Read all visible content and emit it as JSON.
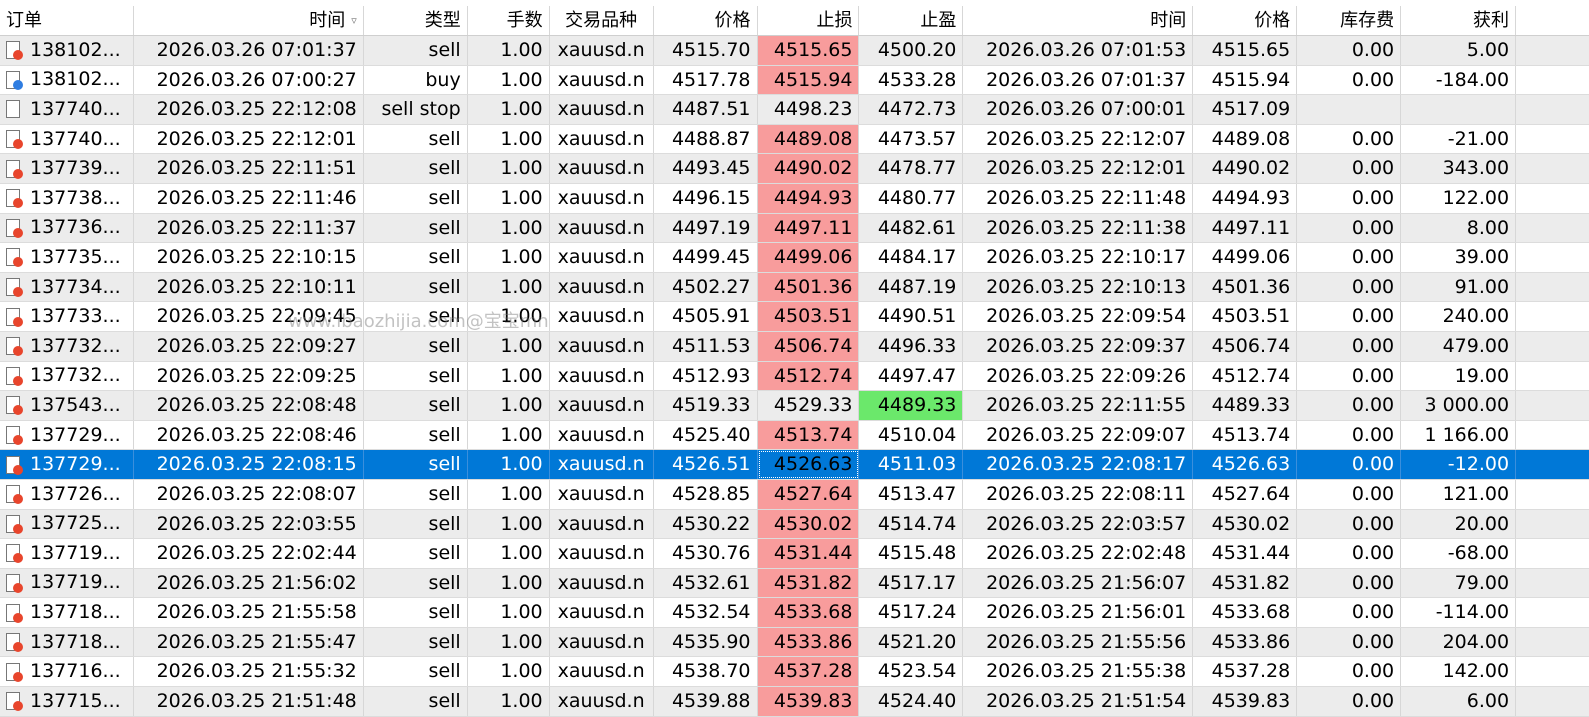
{
  "headers": [
    "订单",
    "时间",
    "类型",
    "手数",
    "交易品种",
    "价格",
    "止损",
    "止盈",
    "时间",
    "价格",
    "库存费",
    "获利"
  ],
  "sort_indicator": "▿",
  "watermark": "www.ibaozhijia.com@宝宝mn",
  "colors": {
    "sl_red": "#f89c9c",
    "tp_green": "#6be86b",
    "selected": "#0078d7",
    "icon_sell": "#e8452c",
    "icon_buy": "#2f7de1"
  },
  "rows": [
    {
      "order": "138102...",
      "time": "2026.03.26 07:01:37",
      "type": "sell",
      "lots": "1.00",
      "symbol": "xauusd.n",
      "price": "4515.70",
      "sl": "4515.65",
      "tp": "4500.20",
      "close_time": "2026.03.26 07:01:53",
      "close_price": "4515.65",
      "swap": "0.00",
      "profit": "5.00",
      "icon": "sell",
      "sl_hl": true,
      "tp_hl": false,
      "selected": false
    },
    {
      "order": "138102...",
      "time": "2026.03.26 07:00:27",
      "type": "buy",
      "lots": "1.00",
      "symbol": "xauusd.n",
      "price": "4517.78",
      "sl": "4515.94",
      "tp": "4533.28",
      "close_time": "2026.03.26 07:01:37",
      "close_price": "4515.94",
      "swap": "0.00",
      "profit": "-184.00",
      "icon": "buy",
      "sl_hl": true,
      "tp_hl": false,
      "selected": false
    },
    {
      "order": "137740...",
      "time": "2026.03.25 22:12:08",
      "type": "sell stop",
      "lots": "1.00",
      "symbol": "xauusd.n",
      "price": "4487.51",
      "sl": "4498.23",
      "tp": "4472.73",
      "close_time": "2026.03.26 07:00:01",
      "close_price": "4517.09",
      "swap": "",
      "profit": "",
      "icon": "pending",
      "sl_hl": false,
      "tp_hl": false,
      "selected": false
    },
    {
      "order": "137740...",
      "time": "2026.03.25 22:12:01",
      "type": "sell",
      "lots": "1.00",
      "symbol": "xauusd.n",
      "price": "4488.87",
      "sl": "4489.08",
      "tp": "4473.57",
      "close_time": "2026.03.25 22:12:07",
      "close_price": "4489.08",
      "swap": "0.00",
      "profit": "-21.00",
      "icon": "sell",
      "sl_hl": true,
      "tp_hl": false,
      "selected": false
    },
    {
      "order": "137739...",
      "time": "2026.03.25 22:11:51",
      "type": "sell",
      "lots": "1.00",
      "symbol": "xauusd.n",
      "price": "4493.45",
      "sl": "4490.02",
      "tp": "4478.77",
      "close_time": "2026.03.25 22:12:01",
      "close_price": "4490.02",
      "swap": "0.00",
      "profit": "343.00",
      "icon": "sell",
      "sl_hl": true,
      "tp_hl": false,
      "selected": false
    },
    {
      "order": "137738...",
      "time": "2026.03.25 22:11:46",
      "type": "sell",
      "lots": "1.00",
      "symbol": "xauusd.n",
      "price": "4496.15",
      "sl": "4494.93",
      "tp": "4480.77",
      "close_time": "2026.03.25 22:11:48",
      "close_price": "4494.93",
      "swap": "0.00",
      "profit": "122.00",
      "icon": "sell",
      "sl_hl": true,
      "tp_hl": false,
      "selected": false
    },
    {
      "order": "137736...",
      "time": "2026.03.25 22:11:37",
      "type": "sell",
      "lots": "1.00",
      "symbol": "xauusd.n",
      "price": "4497.19",
      "sl": "4497.11",
      "tp": "4482.61",
      "close_time": "2026.03.25 22:11:38",
      "close_price": "4497.11",
      "swap": "0.00",
      "profit": "8.00",
      "icon": "sell",
      "sl_hl": true,
      "tp_hl": false,
      "selected": false
    },
    {
      "order": "137735...",
      "time": "2026.03.25 22:10:15",
      "type": "sell",
      "lots": "1.00",
      "symbol": "xauusd.n",
      "price": "4499.45",
      "sl": "4499.06",
      "tp": "4484.17",
      "close_time": "2026.03.25 22:10:17",
      "close_price": "4499.06",
      "swap": "0.00",
      "profit": "39.00",
      "icon": "sell",
      "sl_hl": true,
      "tp_hl": false,
      "selected": false
    },
    {
      "order": "137734...",
      "time": "2026.03.25 22:10:11",
      "type": "sell",
      "lots": "1.00",
      "symbol": "xauusd.n",
      "price": "4502.27",
      "sl": "4501.36",
      "tp": "4487.19",
      "close_time": "2026.03.25 22:10:13",
      "close_price": "4501.36",
      "swap": "0.00",
      "profit": "91.00",
      "icon": "sell",
      "sl_hl": true,
      "tp_hl": false,
      "selected": false
    },
    {
      "order": "137733...",
      "time": "2026.03.25 22:09:45",
      "type": "sell",
      "lots": "1.00",
      "symbol": "xauusd.n",
      "price": "4505.91",
      "sl": "4503.51",
      "tp": "4490.51",
      "close_time": "2026.03.25 22:09:54",
      "close_price": "4503.51",
      "swap": "0.00",
      "profit": "240.00",
      "icon": "sell",
      "sl_hl": true,
      "tp_hl": false,
      "selected": false
    },
    {
      "order": "137732...",
      "time": "2026.03.25 22:09:27",
      "type": "sell",
      "lots": "1.00",
      "symbol": "xauusd.n",
      "price": "4511.53",
      "sl": "4506.74",
      "tp": "4496.33",
      "close_time": "2026.03.25 22:09:37",
      "close_price": "4506.74",
      "swap": "0.00",
      "profit": "479.00",
      "icon": "sell",
      "sl_hl": true,
      "tp_hl": false,
      "selected": false
    },
    {
      "order": "137732...",
      "time": "2026.03.25 22:09:25",
      "type": "sell",
      "lots": "1.00",
      "symbol": "xauusd.n",
      "price": "4512.93",
      "sl": "4512.74",
      "tp": "4497.47",
      "close_time": "2026.03.25 22:09:26",
      "close_price": "4512.74",
      "swap": "0.00",
      "profit": "19.00",
      "icon": "sell",
      "sl_hl": true,
      "tp_hl": false,
      "selected": false
    },
    {
      "order": "137543...",
      "time": "2026.03.25 22:08:48",
      "type": "sell",
      "lots": "1.00",
      "symbol": "xauusd.n",
      "price": "4519.33",
      "sl": "4529.33",
      "tp": "4489.33",
      "close_time": "2026.03.25 22:11:55",
      "close_price": "4489.33",
      "swap": "0.00",
      "profit": "3 000.00",
      "icon": "sell",
      "sl_hl": false,
      "tp_hl": true,
      "selected": false
    },
    {
      "order": "137729...",
      "time": "2026.03.25 22:08:46",
      "type": "sell",
      "lots": "1.00",
      "symbol": "xauusd.n",
      "price": "4525.40",
      "sl": "4513.74",
      "tp": "4510.04",
      "close_time": "2026.03.25 22:09:07",
      "close_price": "4513.74",
      "swap": "0.00",
      "profit": "1 166.00",
      "icon": "sell",
      "sl_hl": true,
      "tp_hl": false,
      "selected": false
    },
    {
      "order": "137729...",
      "time": "2026.03.25 22:08:15",
      "type": "sell",
      "lots": "1.00",
      "symbol": "xauusd.n",
      "price": "4526.51",
      "sl": "4526.63",
      "tp": "4511.03",
      "close_time": "2026.03.25 22:08:17",
      "close_price": "4526.63",
      "swap": "0.00",
      "profit": "-12.00",
      "icon": "sell",
      "sl_hl": true,
      "tp_hl": false,
      "selected": true
    },
    {
      "order": "137726...",
      "time": "2026.03.25 22:08:07",
      "type": "sell",
      "lots": "1.00",
      "symbol": "xauusd.n",
      "price": "4528.85",
      "sl": "4527.64",
      "tp": "4513.47",
      "close_time": "2026.03.25 22:08:11",
      "close_price": "4527.64",
      "swap": "0.00",
      "profit": "121.00",
      "icon": "sell",
      "sl_hl": true,
      "tp_hl": false,
      "selected": false
    },
    {
      "order": "137725...",
      "time": "2026.03.25 22:03:55",
      "type": "sell",
      "lots": "1.00",
      "symbol": "xauusd.n",
      "price": "4530.22",
      "sl": "4530.02",
      "tp": "4514.74",
      "close_time": "2026.03.25 22:03:57",
      "close_price": "4530.02",
      "swap": "0.00",
      "profit": "20.00",
      "icon": "sell",
      "sl_hl": true,
      "tp_hl": false,
      "selected": false
    },
    {
      "order": "137719...",
      "time": "2026.03.25 22:02:44",
      "type": "sell",
      "lots": "1.00",
      "symbol": "xauusd.n",
      "price": "4530.76",
      "sl": "4531.44",
      "tp": "4515.48",
      "close_time": "2026.03.25 22:02:48",
      "close_price": "4531.44",
      "swap": "0.00",
      "profit": "-68.00",
      "icon": "sell",
      "sl_hl": true,
      "tp_hl": false,
      "selected": false
    },
    {
      "order": "137719...",
      "time": "2026.03.25 21:56:02",
      "type": "sell",
      "lots": "1.00",
      "symbol": "xauusd.n",
      "price": "4532.61",
      "sl": "4531.82",
      "tp": "4517.17",
      "close_time": "2026.03.25 21:56:07",
      "close_price": "4531.82",
      "swap": "0.00",
      "profit": "79.00",
      "icon": "sell",
      "sl_hl": true,
      "tp_hl": false,
      "selected": false
    },
    {
      "order": "137718...",
      "time": "2026.03.25 21:55:58",
      "type": "sell",
      "lots": "1.00",
      "symbol": "xauusd.n",
      "price": "4532.54",
      "sl": "4533.68",
      "tp": "4517.24",
      "close_time": "2026.03.25 21:56:01",
      "close_price": "4533.68",
      "swap": "0.00",
      "profit": "-114.00",
      "icon": "sell",
      "sl_hl": true,
      "tp_hl": false,
      "selected": false
    },
    {
      "order": "137718...",
      "time": "2026.03.25 21:55:47",
      "type": "sell",
      "lots": "1.00",
      "symbol": "xauusd.n",
      "price": "4535.90",
      "sl": "4533.86",
      "tp": "4521.20",
      "close_time": "2026.03.25 21:55:56",
      "close_price": "4533.86",
      "swap": "0.00",
      "profit": "204.00",
      "icon": "sell",
      "sl_hl": true,
      "tp_hl": false,
      "selected": false
    },
    {
      "order": "137716...",
      "time": "2026.03.25 21:55:32",
      "type": "sell",
      "lots": "1.00",
      "symbol": "xauusd.n",
      "price": "4538.70",
      "sl": "4537.28",
      "tp": "4523.54",
      "close_time": "2026.03.25 21:55:38",
      "close_price": "4537.28",
      "swap": "0.00",
      "profit": "142.00",
      "icon": "sell",
      "sl_hl": true,
      "tp_hl": false,
      "selected": false
    },
    {
      "order": "137715...",
      "time": "2026.03.25 21:51:48",
      "type": "sell",
      "lots": "1.00",
      "symbol": "xauusd.n",
      "price": "4539.88",
      "sl": "4539.83",
      "tp": "4524.40",
      "close_time": "2026.03.25 21:51:54",
      "close_price": "4539.83",
      "swap": "0.00",
      "profit": "6.00",
      "icon": "sell",
      "sl_hl": true,
      "tp_hl": false,
      "selected": false
    }
  ]
}
